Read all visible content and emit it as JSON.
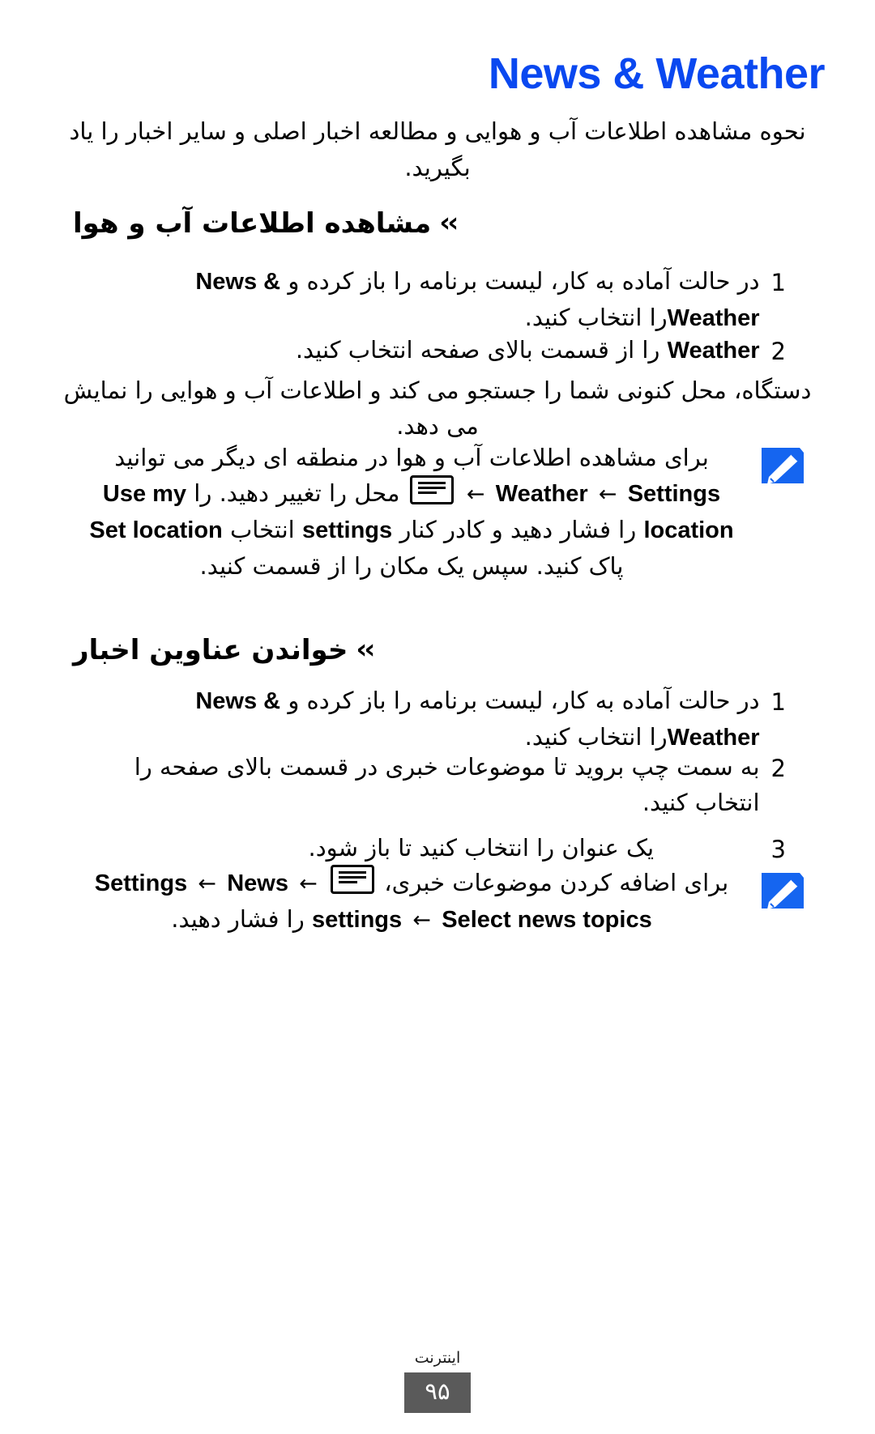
{
  "document": {
    "title": "News & Weather",
    "title_color": "#0a48f0",
    "intro": "نحوه مشاهده اطلاعات آب و هوایی و مطالعه اخبار اصلی و سایر اخبار را یاد بگیرید."
  },
  "sections": [
    {
      "id": "weather",
      "marker": "››",
      "heading": "مشاهده اطلاعات آب و هوا",
      "steps": [
        {
          "number": "1",
          "line1": "در حالت آماده به کار، لیست برنامه را باز کرده و",
          "latin": "News & Weather",
          "line2": "را انتخاب کنید."
        },
        {
          "number": "2",
          "latin": "Weather",
          "line1": "را از قسمت بالای صفحه انتخاب کنید."
        }
      ],
      "paragraph": "دستگاه، محل کنونی شما را جستجو می کند و اطلاعات آب و هوایی را نمایش می دهد.",
      "note": {
        "icon": "note-pen-icon",
        "line1": "برای مشاهده اطلاعات آب و هوا در منطقه ای دیگر می توانید",
        "line2_pre": "محل را تغییر دهید.",
        "key": "menu-key",
        "seq1_a": "Settings",
        "seq1_b": "Weather",
        "line3_a": "settings",
        "line3_b": "را فشار دهید و کادر کنار",
        "line3_c": "Use my location",
        "line3_d": "را",
        "line4_a": "پاک کنید. سپس یک مکان را از قسمت",
        "line4_b": "Set location",
        "line4_c": "انتخاب",
        "line5": "کنید."
      }
    },
    {
      "id": "news",
      "marker": "››",
      "heading": "خواندن عناوین اخبار",
      "steps": [
        {
          "number": "1",
          "line1": "در حالت آماده به کار، لیست برنامه را باز کرده و",
          "latin": "News & Weather",
          "line2": "را انتخاب کنید."
        },
        {
          "number": "2",
          "line1": "به سمت چپ بروید تا موضوعات خبری در قسمت بالای صفحه را انتخاب کنید."
        },
        {
          "number": "3",
          "line1": "یک عنوان را انتخاب کنید تا باز شود."
        }
      ],
      "note": {
        "icon": "note-pen-icon",
        "line1_a": "برای اضافه کردن موضوعات خبری،",
        "key": "menu-key",
        "seq_a": "Settings",
        "seq_b": "News settings",
        "seq_c": "Select news topics",
        "line2_tail": "را فشار دهید."
      }
    }
  ],
  "footer": {
    "chapter": "اینترنت",
    "page_number": "۹۵"
  },
  "symbols": {
    "arrow_left": "←",
    "chevrons": "››"
  }
}
